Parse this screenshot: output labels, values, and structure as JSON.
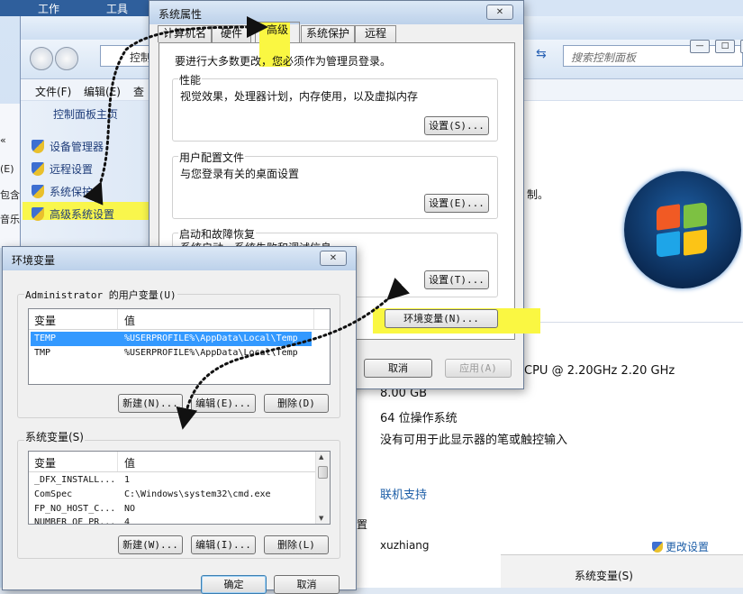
{
  "top_menu": {
    "work": "工作",
    "tools": "工具"
  },
  "control_panel": {
    "address_text": "控制",
    "search_placeholder": "搜索控制面板",
    "menu": {
      "file": "文件(F)",
      "edit": "编辑(E)",
      "view": "查"
    },
    "sidebar": {
      "home": "控制面板主页",
      "items": [
        {
          "label": "设备管理器"
        },
        {
          "label": "远程设置"
        },
        {
          "label": "系统保护"
        },
        {
          "label": "高级系统设置"
        }
      ]
    },
    "left_strip": {
      "chev": "«",
      "a": "(E)",
      "b": "包含",
      "c": "音乐"
    },
    "right_fragment": "制。",
    "system_info": {
      "cpu": "CPU @ 2.20GHz   2.20 GHz",
      "ram": "8.00 GB",
      "os_type": "64 位操作系统",
      "pen": "没有可用于此显示器的笔或触控输入",
      "support_link": "联机支持",
      "frag": "置",
      "user": "xuzhiang",
      "change_settings": "更改设置"
    },
    "bottom_fragment": "系统变量(S)"
  },
  "system_properties": {
    "title": "系统属性",
    "close": "✕",
    "tabs": [
      {
        "label": "计算机名"
      },
      {
        "label": "硬件"
      },
      {
        "label": "高级"
      },
      {
        "label": "系统保护"
      },
      {
        "label": "远程"
      }
    ],
    "admin_note": "要进行大多数更改，您必须作为管理员登录。",
    "performance": {
      "title": "性能",
      "desc": "视觉效果，处理器计划，内存使用，以及虚拟内存",
      "button": "设置(S)..."
    },
    "user_profiles": {
      "title": "用户配置文件",
      "desc": "与您登录有关的桌面设置",
      "button": "设置(E)..."
    },
    "startup": {
      "title": "启动和故障恢复",
      "desc": "系统启动、系统失败和调试信息",
      "button": "设置(T)..."
    },
    "env_button": "环境变量(N)...",
    "cancel": "取消",
    "apply": "应用(A)"
  },
  "environment_variables": {
    "title": "环境变量",
    "close": "✕",
    "user_group": "Administrator 的用户变量(U)",
    "col_var": "变量",
    "col_val": "值",
    "user_vars": [
      {
        "name": "TEMP",
        "value": "%USERPROFILE%\\AppData\\Local\\Temp"
      },
      {
        "name": "TMP",
        "value": "%USERPROFILE%\\AppData\\Local\\Temp"
      }
    ],
    "user_buttons": {
      "new": "新建(N)...",
      "edit": "编辑(E)...",
      "delete": "删除(D)"
    },
    "system_group": "系统变量(S)",
    "sys_vars": [
      {
        "name": "_DFX_INSTALL...",
        "value": "1"
      },
      {
        "name": "ComSpec",
        "value": "C:\\Windows\\system32\\cmd.exe"
      },
      {
        "name": "FP_NO_HOST_C...",
        "value": "NO"
      },
      {
        "name": "NUMBER_OF_PR...",
        "value": "4"
      }
    ],
    "sys_buttons": {
      "new": "新建(W)...",
      "edit": "编辑(I)...",
      "delete": "删除(L)"
    },
    "ok": "确定",
    "cancel": "取消"
  },
  "colors": {
    "highlight": "#faf742",
    "selection": "#3399ff",
    "link": "#1d5ea7"
  }
}
